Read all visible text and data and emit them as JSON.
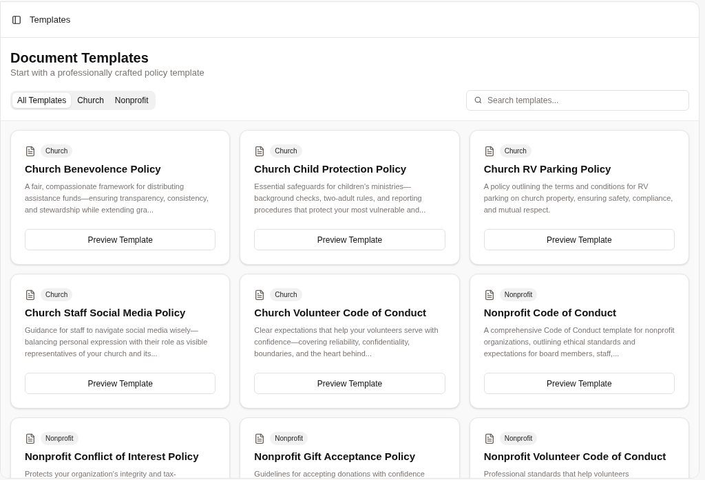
{
  "header": {
    "title": "Templates"
  },
  "page": {
    "title": "Document Templates",
    "subtitle": "Start with a professionally crafted policy template"
  },
  "filters": [
    {
      "label": "All Templates",
      "selected": true
    },
    {
      "label": "Church",
      "selected": false
    },
    {
      "label": "Nonprofit",
      "selected": false
    }
  ],
  "search": {
    "placeholder": "Search templates..."
  },
  "templates": [
    {
      "tag": "Church",
      "title": "Church Benevolence Policy",
      "description": "A fair, compassionate framework for distributing assistance funds—ensuring transparency, consistency, and stewardship while extending gra...",
      "button": "Preview Template"
    },
    {
      "tag": "Church",
      "title": "Church Child Protection Policy",
      "description": "Essential safeguards for children's ministries—background checks, two-adult rules, and reporting procedures that protect your most vulnerable and...",
      "button": "Preview Template"
    },
    {
      "tag": "Church",
      "title": "Church RV Parking Policy",
      "description": "A policy outlining the terms and conditions for RV parking on church property, ensuring safety, compliance, and mutual respect.",
      "button": "Preview Template"
    },
    {
      "tag": "Church",
      "title": "Church Staff Social Media Policy",
      "description": "Guidance for staff to navigate social media wisely—balancing personal expression with their role as visible representatives of your church and its...",
      "button": "Preview Template"
    },
    {
      "tag": "Church",
      "title": "Church Volunteer Code of Conduct",
      "description": "Clear expectations that help your volunteers serve with confidence—covering reliability, confidentiality, boundaries, and the heart behind...",
      "button": "Preview Template"
    },
    {
      "tag": "Nonprofit",
      "title": "Nonprofit Code of Conduct",
      "description": "A comprehensive Code of Conduct template for nonprofit organizations, outlining ethical standards and expectations for board members, staff,...",
      "button": "Preview Template"
    },
    {
      "tag": "Nonprofit",
      "title": "Nonprofit Conflict of Interest Policy",
      "description": "Protects your organization's integrity and tax-"
    },
    {
      "tag": "Nonprofit",
      "title": "Nonprofit Gift Acceptance Policy",
      "description": "Guidelines for accepting donations with confidence"
    },
    {
      "tag": "Nonprofit",
      "title": "Nonprofit Volunteer Code of Conduct",
      "description": "Professional standards that help volunteers"
    }
  ]
}
